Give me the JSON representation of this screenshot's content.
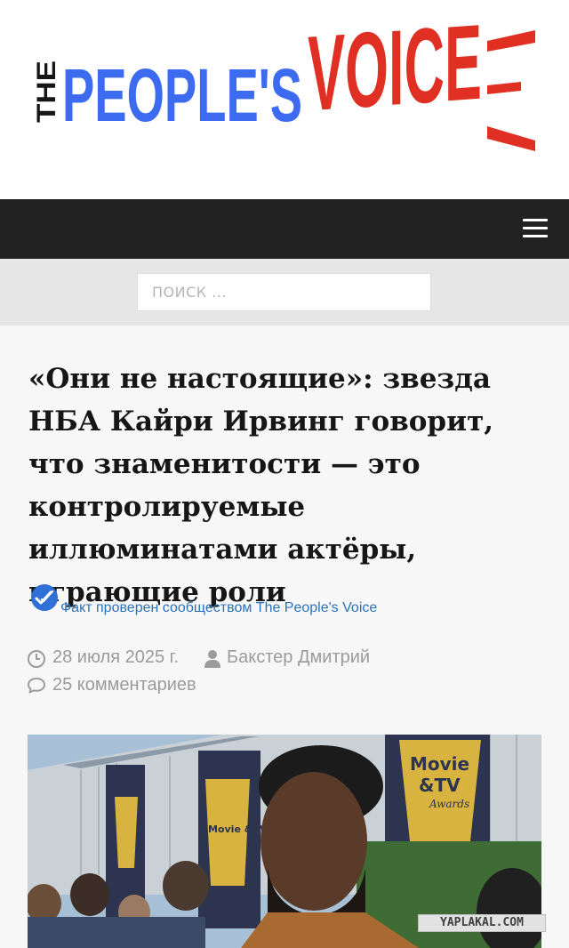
{
  "logo": {
    "the": "THE",
    "peoples": "PEOPLE'S",
    "voice": "VOICE",
    "colors": {
      "blue": "#3d6bf0",
      "red": "#e03023",
      "black": "#161616"
    }
  },
  "nav": {
    "menu_icon": "hamburger-icon"
  },
  "search": {
    "placeholder": "ПОИСК ..."
  },
  "article": {
    "title": "«Они не настоящие»: звезда НБА Кайри Ирвинг говорит, что знаменитости — это контролируемые иллюминатами актёры, играющие роли",
    "fact_check": "Факт проверен сообществом The People's Voice",
    "date": "28 июля 2025 г.",
    "author": "Бакстер Дмитрий",
    "comments": "25 комментариев",
    "icons": {
      "fact": "check-badge-icon",
      "date": "clock-icon",
      "author": "user-icon",
      "comments": "comment-icon"
    },
    "image": {
      "banner_top": "Movie",
      "banner_amp": "&TV",
      "banner_awards": "Awards",
      "banner_small": "Movie &TV"
    }
  },
  "watermark": "YAPLAKAL.COM"
}
